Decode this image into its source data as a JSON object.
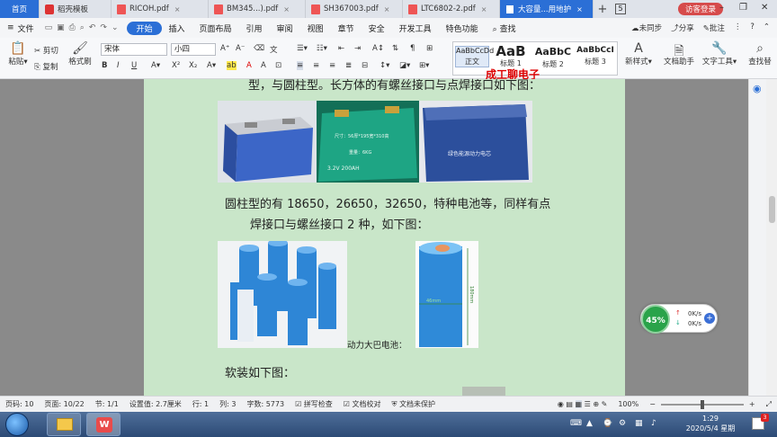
{
  "tabs": [
    {
      "label": "首页",
      "type": "home"
    },
    {
      "label": "稻壳模板",
      "type": "wps"
    },
    {
      "label": "RICOH.pdf",
      "type": "pdf"
    },
    {
      "label": "BM345...).pdf",
      "type": "pdf"
    },
    {
      "label": "SH367003.pdf",
      "type": "pdf"
    },
    {
      "label": "LTC6802-2.pdf",
      "type": "pdf"
    },
    {
      "label": "大容量...用地护",
      "type": "doc"
    }
  ],
  "tab_count": "5",
  "guest_label": "访客登录",
  "menu": {
    "file": "文件",
    "items": [
      "开始",
      "插入",
      "页面布局",
      "引用",
      "审阅",
      "视图",
      "章节",
      "安全",
      "开发工具",
      "特色功能"
    ],
    "search": "查找",
    "unsynced": "未同步",
    "share": "分享",
    "comment": "批注"
  },
  "ribbon": {
    "paste": "粘贴",
    "cut": "剪切",
    "copy": "复制",
    "format_painter": "格式刷",
    "font_name": "宋体",
    "font_size": "小四",
    "styles": [
      {
        "preview": "AaBbCcDd",
        "label": "正文"
      },
      {
        "preview": "AaB",
        "label": "标题 1"
      },
      {
        "preview": "AaBbC",
        "label": "标题 2"
      },
      {
        "preview": "AaBbCcI",
        "label": "标题 3"
      }
    ],
    "new_style": "新样式",
    "doc_helper": "文档助手",
    "text_tools": "文字工具",
    "find_replace": "查找替"
  },
  "watermark_text": "成工聊电子",
  "document": {
    "line1": "型，与圆柱型。长方体的有螺丝接口与点焊接口如下图：",
    "line2": "圆柱型的有 18650，26650，32650，特种电池等，同样有点",
    "line3": "焊接口与螺丝接口 2 种，如下图：",
    "caption": "动力大巴电池：",
    "line4": "软装如下图：",
    "img_label_mid": "尺寸：56厚*195宽*310高",
    "img_label_mid2": "重量：6KG",
    "img_label_mid3": "3.2V  200AH",
    "img_label_right": "绿色能源动力电芯",
    "img_dim_side": "180mm",
    "img_dim_width": "46mm"
  },
  "network": {
    "percent": "45%",
    "up": "0K/s",
    "down": "0K/s"
  },
  "status": {
    "page": "页码: 10",
    "pages": "页面: 10/22",
    "section": "节: 1/1",
    "position": "设置值: 2.7厘米",
    "row": "行: 1",
    "col": "列: 3",
    "words": "字数: 5773",
    "spell": "拼写检查",
    "proof": "文档校对",
    "protect": "文档未保护",
    "zoom": "100%"
  },
  "clock": {
    "time": "1:29",
    "date": "2020/5/4 星期一"
  },
  "colors": {
    "accent": "#2b6fd6",
    "page_bg": "#c9e6c9",
    "battery_blue": "#2e86d6"
  }
}
